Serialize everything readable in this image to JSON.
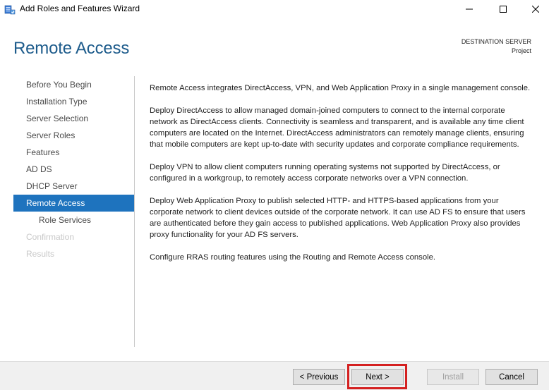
{
  "window": {
    "title": "Add Roles and Features Wizard",
    "icon": "server-manager-icon"
  },
  "header": {
    "title": "Remote Access",
    "destination_label": "DESTINATION SERVER",
    "destination_value": "Project"
  },
  "nav": {
    "items": [
      {
        "label": "Before You Begin",
        "state": "normal"
      },
      {
        "label": "Installation Type",
        "state": "normal"
      },
      {
        "label": "Server Selection",
        "state": "normal"
      },
      {
        "label": "Server Roles",
        "state": "normal"
      },
      {
        "label": "Features",
        "state": "normal"
      },
      {
        "label": "AD DS",
        "state": "normal"
      },
      {
        "label": "DHCP Server",
        "state": "normal"
      },
      {
        "label": "Remote Access",
        "state": "active"
      },
      {
        "label": "Role Services",
        "state": "sub"
      },
      {
        "label": "Confirmation",
        "state": "disabled"
      },
      {
        "label": "Results",
        "state": "disabled"
      }
    ]
  },
  "content": {
    "paragraphs": [
      "Remote Access integrates DirectAccess, VPN, and Web Application Proxy in a single management console.",
      "Deploy DirectAccess to allow managed domain-joined computers to connect to the internal corporate network as DirectAccess clients. Connectivity is seamless and transparent, and is available any time client computers are located on the Internet. DirectAccess administrators can remotely manage clients, ensuring that mobile computers are kept up-to-date with security updates and corporate compliance requirements.",
      "Deploy VPN to allow client computers running operating systems not supported by DirectAccess, or configured in a workgroup, to remotely access corporate networks over a VPN connection.",
      "Deploy Web Application Proxy to publish selected HTTP- and HTTPS-based applications from your corporate network to client devices outside of the corporate network. It can use AD FS to ensure that users are authenticated before they gain access to published applications. Web Application Proxy also provides proxy functionality for your AD FS servers.",
      "Configure RRAS routing features using the Routing and Remote Access console."
    ]
  },
  "footer": {
    "previous_label": "< Previous",
    "next_label": "Next >",
    "install_label": "Install",
    "cancel_label": "Cancel"
  },
  "colors": {
    "accent": "#1e73be",
    "title": "#1e5c8c",
    "highlight": "#d42020"
  }
}
